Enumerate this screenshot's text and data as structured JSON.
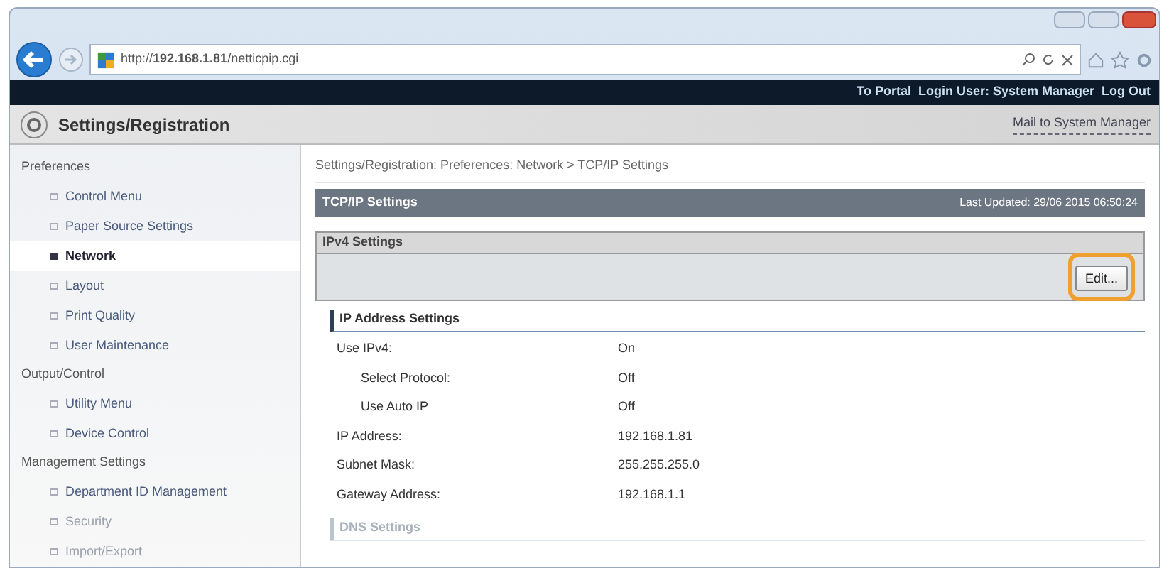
{
  "browser": {
    "url": "http://**192.168.1.81**/netticpip.cgi"
  },
  "top_bar": {
    "links": [
      "To Portal",
      "Login User: System Manager",
      "Log Out"
    ]
  },
  "header": {
    "title": "Settings/Registration",
    "mail_link": "Mail to System Manager"
  },
  "sidebar": {
    "groups": [
      {
        "title": "Preferences",
        "items": [
          {
            "label": "Control Menu",
            "selected": false
          },
          {
            "label": "Paper Source Settings",
            "selected": false
          },
          {
            "label": "Network",
            "selected": true
          },
          {
            "label": "Layout",
            "selected": false
          },
          {
            "label": "Print Quality",
            "selected": false
          },
          {
            "label": "User Maintenance",
            "selected": false
          }
        ]
      },
      {
        "title": "Output/Control",
        "items": [
          {
            "label": "Utility Menu",
            "selected": false
          },
          {
            "label": "Device Control",
            "selected": false
          }
        ]
      },
      {
        "title": "Management Settings",
        "items": [
          {
            "label": "Department ID Management",
            "selected": false
          },
          {
            "label": "Security",
            "selected": false
          },
          {
            "label": "Import/Export",
            "selected": false
          }
        ]
      }
    ]
  },
  "breadcrumb": "Settings/Registration: Preferences: Network > TCP/IP Settings",
  "panel": {
    "title": "TCP/IP Settings",
    "last_updated": "Last Updated: 29/06 2015 06:50:24"
  },
  "section": {
    "title": "IPv4 Settings",
    "edit_button": "Edit..."
  },
  "groups": [
    {
      "title": "IP Address Settings",
      "rows": [
        {
          "label": "Use IPv4:",
          "value": "On",
          "children": [
            {
              "label": "Select Protocol:",
              "value": "Off"
            },
            {
              "label": "Use Auto IP",
              "value": "Off"
            }
          ]
        },
        {
          "label": "IP Address:",
          "value": "192.168.1.81"
        },
        {
          "label": "Subnet Mask:",
          "value": "255.255.255.0"
        },
        {
          "label": "Gateway Address:",
          "value": "192.168.1.1"
        }
      ]
    },
    {
      "title": "DNS Settings"
    }
  ]
}
